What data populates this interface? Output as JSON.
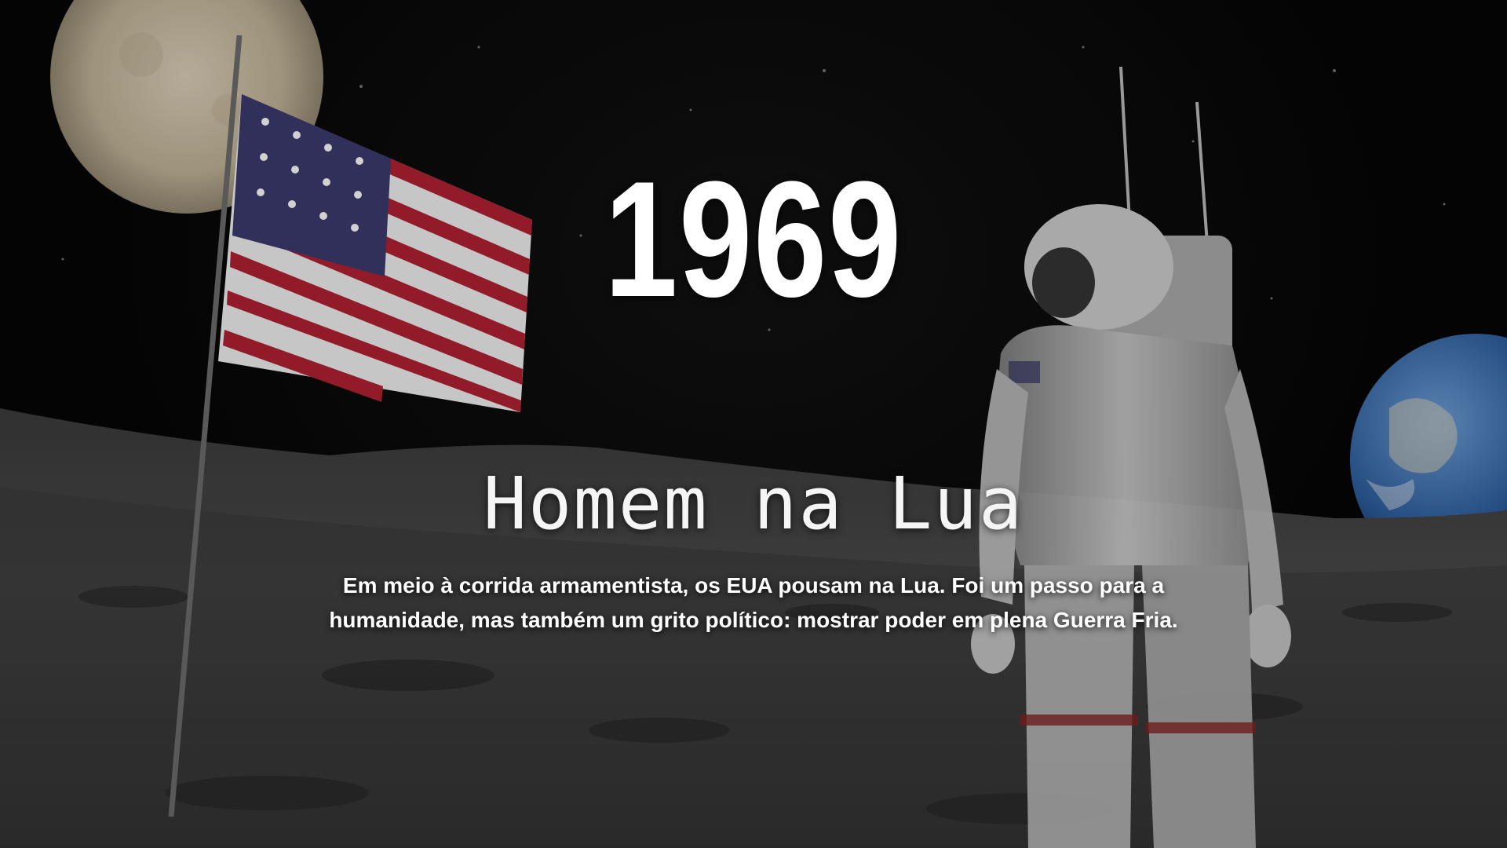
{
  "slide": {
    "year": "1969",
    "title": "Homem na Lua",
    "description_lines": [
      "Em meio à corrida armamentista, os EUA pousam na Lua. Foi um passo para a",
      "humanidade, mas também um grito político: mostrar poder em plena Guerra Fria."
    ]
  },
  "colors": {
    "text": "#ffffff",
    "flag_red": "#b22234",
    "flag_blue": "#3c3b6e",
    "space": "#050505",
    "earth_blue": "#2e5f9e"
  }
}
